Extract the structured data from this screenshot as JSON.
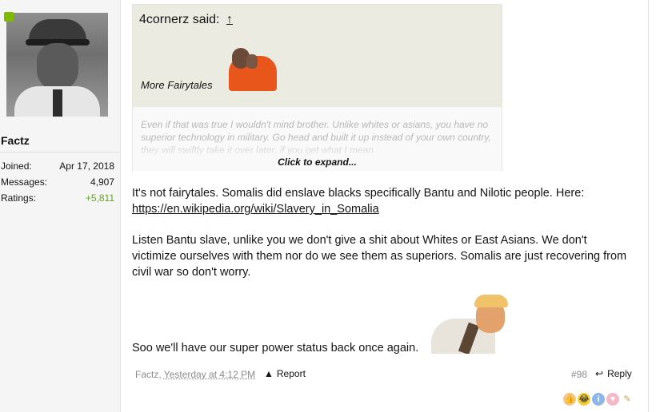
{
  "user": {
    "name": "Factz",
    "stats": [
      {
        "label": "Joined:",
        "value": "Apr 17, 2018"
      },
      {
        "label": "Messages:",
        "value": "4,907"
      },
      {
        "label": "Ratings:",
        "value": "+5,811"
      }
    ]
  },
  "quote": {
    "author": "4cornerz said:",
    "jump_icon": "↑",
    "image_caption": "More Fairytales",
    "body": "Even if that was true I wouldn't mind brother. Unlike whites or asians, you have no superior technology in military. Go head and built it up instead of your own country, they will swiftly take it over later. if you get what I mean",
    "expand_label": "Click to expand..."
  },
  "message": {
    "p1": "It's not fairytales. Somalis did enslave blacks specifically Bantu and Nilotic people. Here:",
    "link": "https://en.wikipedia.org/wiki/Slavery_in_Somalia",
    "p2": "Listen Bantu slave, unlike you we don't give a shit about Whites or East Asians. We don't victimize ourselves with them nor do we see them as superiors. Somalis are just recovering from civil war so don't worry.",
    "p3": "Soo we'll have our super power status back once again."
  },
  "footer": {
    "author": "Factz,",
    "time": "Yesterday at 4:12 PM",
    "report_label": "Report",
    "post_number": "#98",
    "reply_label": "Reply"
  },
  "icons": {
    "report": "warning-icon",
    "reply": "reply-arrow-icon",
    "online": "online-indicator-icon"
  },
  "colors": {
    "online": "#7fb900",
    "ratings_positive": "#5ea51e",
    "quote_header_bg": "#ebebe2"
  }
}
